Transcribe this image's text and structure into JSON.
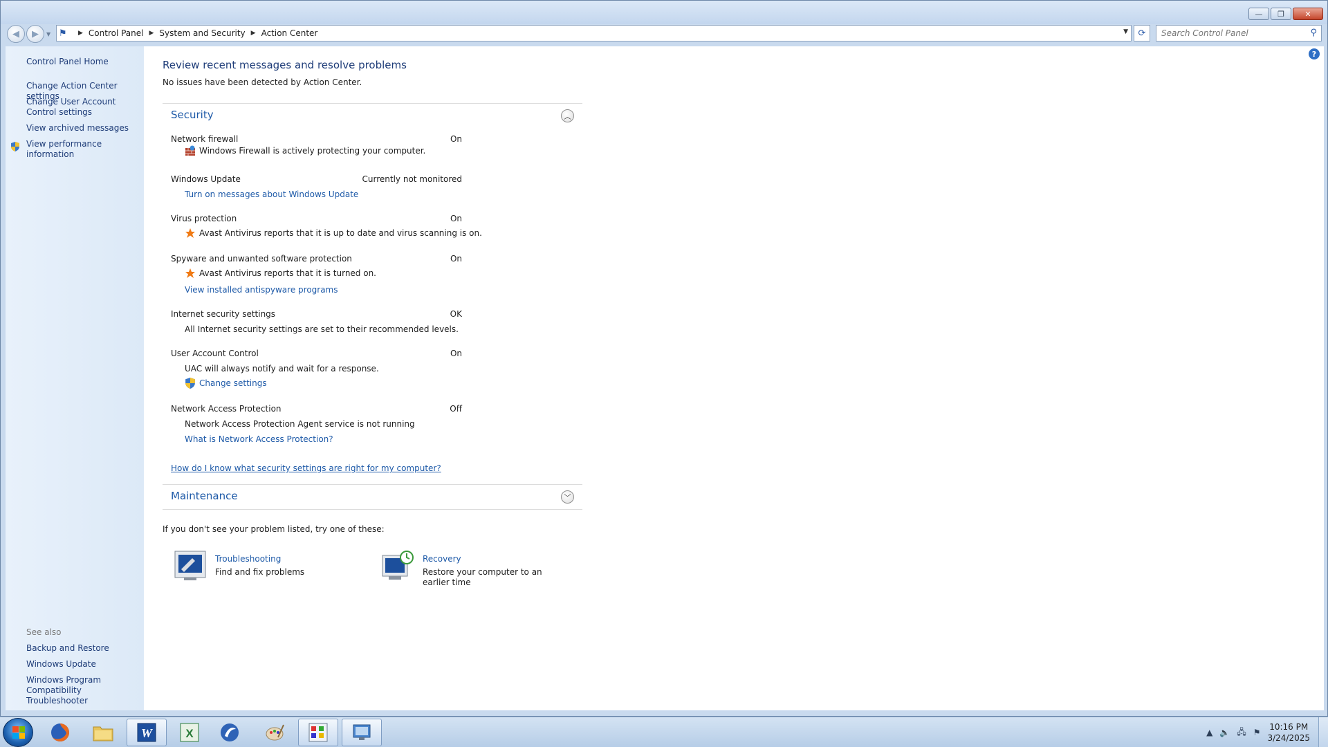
{
  "window": {
    "minimize_glyph": "—",
    "maximize_glyph": "❐",
    "close_glyph": "✕"
  },
  "address": {
    "crumbs": [
      "Control Panel",
      "System and Security",
      "Action Center"
    ],
    "search_placeholder": "Search Control Panel"
  },
  "sidebar": {
    "home": "Control Panel Home",
    "links": [
      "Change Action Center settings",
      "Change User Account Control settings",
      "View archived messages",
      "View performance information"
    ],
    "see_also_label": "See also",
    "see_also": [
      "Backup and Restore",
      "Windows Update",
      "Windows Program Compatibility Troubleshooter"
    ]
  },
  "main": {
    "heading": "Review recent messages and resolve problems",
    "subheading": "No issues have been detected by Action Center.",
    "security": {
      "title": "Security",
      "rows": [
        {
          "label": "Network firewall",
          "status": "On",
          "desc": "Windows Firewall is actively protecting your computer."
        },
        {
          "label": "Windows Update",
          "status": "Currently not monitored",
          "link": "Turn on messages about Windows Update"
        },
        {
          "label": "Virus protection",
          "status": "On",
          "desc": "Avast Antivirus reports that it is up to date and virus scanning is on."
        },
        {
          "label": "Spyware and unwanted software protection",
          "status": "On",
          "desc": "Avast Antivirus reports that it is turned on.",
          "link": "View installed antispyware programs"
        },
        {
          "label": "Internet security settings",
          "status": "OK",
          "desc": "All Internet security settings are set to their recommended levels."
        },
        {
          "label": "User Account Control",
          "status": "On",
          "desc": "UAC will always notify and wait for a response.",
          "link": "Change settings"
        },
        {
          "label": "Network Access Protection",
          "status": "Off",
          "desc": "Network Access Protection Agent service is not running",
          "link": "What is Network Access Protection?"
        }
      ],
      "help_link": "How do I know what security settings are right for my computer?"
    },
    "maintenance": {
      "title": "Maintenance"
    },
    "try_text": "If you don't see your problem listed, try one of these:",
    "tiles": [
      {
        "title": "Troubleshooting",
        "desc": "Find and fix problems"
      },
      {
        "title": "Recovery",
        "desc": "Restore your computer to an earlier time"
      }
    ]
  },
  "taskbar": {
    "apps": [
      "firefox-icon",
      "file-explorer-icon",
      "word-icon",
      "excel-icon",
      "steam-icon",
      "paint-icon",
      "task-manager-icon",
      "control-panel-icon"
    ],
    "time": "10:16 PM",
    "date": "3/24/2025"
  },
  "colors": {
    "link": "#1e5aa8",
    "heading": "#1e3c78",
    "sidebar_bg": "#dce9f7"
  }
}
